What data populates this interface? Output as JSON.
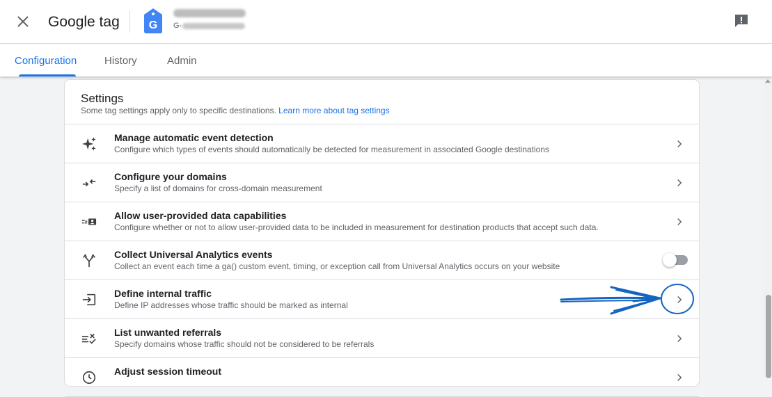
{
  "header": {
    "title": "Google tag",
    "account_id_prefix": "G-",
    "close_icon": "close-icon",
    "feedback_icon": "feedback-icon"
  },
  "tabs": [
    {
      "label": "Configuration",
      "active": true
    },
    {
      "label": "History",
      "active": false
    },
    {
      "label": "Admin",
      "active": false
    }
  ],
  "settings": {
    "title": "Settings",
    "subtitle": "Some tag settings apply only to specific destinations.",
    "link": "Learn more about tag settings",
    "rows": [
      {
        "title": "Manage automatic event detection",
        "description": "Configure which types of events should automatically be detected for measurement in associated Google destinations",
        "icon": "sparkle-icon",
        "control": "chevron"
      },
      {
        "title": "Configure your domains",
        "description": "Specify a list of domains for cross-domain measurement",
        "icon": "merge-arrows-icon",
        "control": "chevron"
      },
      {
        "title": "Allow user-provided data capabilities",
        "description": "Configure whether or not to allow user-provided data to be included in measurement for destination products that accept such data.",
        "icon": "user-data-icon",
        "control": "chevron"
      },
      {
        "title": "Collect Universal Analytics events",
        "description": "Collect an event each time a ga() custom event, timing, or exception call from Universal Analytics occurs on your website",
        "icon": "fork-arrows-icon",
        "control": "toggle",
        "toggle_on": false
      },
      {
        "title": "Define internal traffic",
        "description": "Define IP addresses whose traffic should be marked as internal",
        "icon": "input-icon",
        "control": "chevron"
      },
      {
        "title": "List unwanted referrals",
        "description": "Specify domains whose traffic should not be considered to be referrals",
        "icon": "rule-icon",
        "control": "chevron"
      },
      {
        "title": "Adjust session timeout",
        "description": "",
        "icon": "clock-icon",
        "control": "chevron"
      }
    ]
  },
  "colors": {
    "accent": "#1a73e8",
    "tag_logo": "#4285f4",
    "annotation": "#1565c0"
  }
}
